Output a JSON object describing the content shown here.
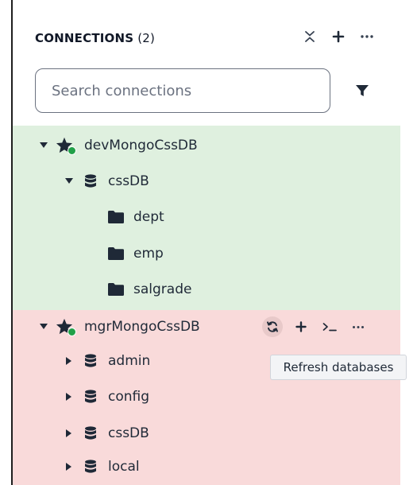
{
  "header": {
    "title": "CONNECTIONS",
    "count": "(2)"
  },
  "search": {
    "placeholder": "Search connections"
  },
  "connections": [
    {
      "name": "devMongoCssDB",
      "color": "#dff0df",
      "status_color": "#21a048",
      "databases": [
        {
          "name": "cssDB",
          "collections": [
            "dept",
            "emp",
            "salgrade"
          ]
        }
      ]
    },
    {
      "name": "mgrMongoCssDB",
      "color": "#f9dada",
      "status_color": "#21a048",
      "databases": [
        {
          "name": "admin"
        },
        {
          "name": "config"
        },
        {
          "name": "cssDB"
        },
        {
          "name": "local"
        }
      ]
    }
  ],
  "tooltip": {
    "text": "Refresh databases"
  },
  "icons": {
    "collapse": "collapse-icon",
    "add": "plus-icon",
    "more": "ellipsis-icon",
    "filter": "funnel-icon",
    "refresh": "refresh-icon",
    "shell": "terminal-icon",
    "star": "star-icon",
    "database": "database-icon",
    "folder": "folder-icon"
  }
}
